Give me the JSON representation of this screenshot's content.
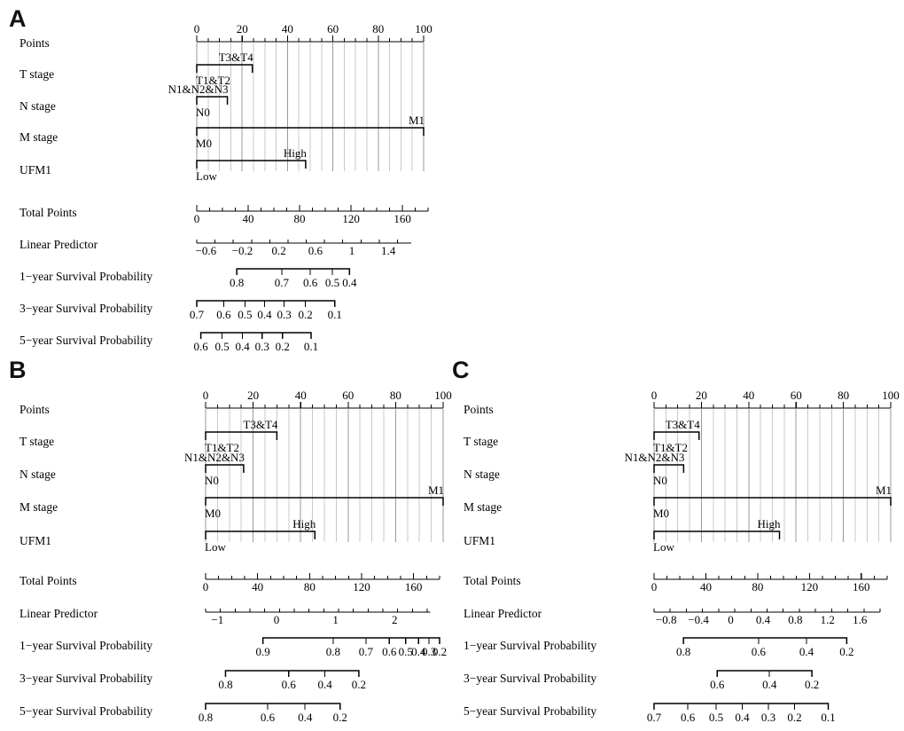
{
  "figure": {
    "type": "nomogram-figure",
    "panels": [
      "A",
      "B",
      "C"
    ]
  },
  "row_labels": {
    "points": "Points",
    "t_stage": "T stage",
    "n_stage": "N stage",
    "m_stage": "M stage",
    "ufm1": "UFM1",
    "total_points": "Total Points",
    "linear_predictor": "Linear Predictor",
    "surv1": "1−year Survival Probability",
    "surv3": "3−year Survival Probability",
    "surv5": "5−year Survival Probability"
  },
  "category_labels": {
    "t_low": "T1&T2",
    "t_high": "T3&T4",
    "n_low": "N0",
    "n_high": "N1&N2&N3",
    "m_low": "M0",
    "m_high": "M1",
    "ufm1_low": "Low",
    "ufm1_high": "High"
  },
  "chart_data": [
    {
      "id": "A",
      "type": "nomogram",
      "title": "A",
      "points_axis": {
        "label": "Points",
        "min": 0,
        "max": 100,
        "ticks": [
          0,
          20,
          40,
          60,
          80,
          100
        ],
        "tick_labels": [
          "0",
          "20",
          "40",
          "60",
          "80",
          "100"
        ],
        "minor_step": 5
      },
      "predictors": [
        {
          "name": "T stage",
          "levels": [
            {
              "label": "T1&T2",
              "points": 0,
              "side": "below"
            },
            {
              "label": "T3&T4",
              "points": 24.5,
              "side": "above"
            }
          ]
        },
        {
          "name": "N stage",
          "levels": [
            {
              "label": "N0",
              "points": 0,
              "side": "below"
            },
            {
              "label": "N1&N2&N3",
              "points": 13.5,
              "side": "above"
            }
          ]
        },
        {
          "name": "M stage",
          "levels": [
            {
              "label": "M0",
              "points": 0,
              "side": "below"
            },
            {
              "label": "M1",
              "points": 100,
              "side": "above"
            }
          ]
        },
        {
          "name": "UFM1",
          "levels": [
            {
              "label": "Low",
              "points": 0,
              "side": "below"
            },
            {
              "label": "High",
              "points": 48,
              "side": "above"
            }
          ]
        }
      ],
      "total_points": {
        "label": "Total Points",
        "min": 0,
        "max": 180,
        "ticks": [
          0,
          40,
          80,
          120,
          160
        ],
        "tick_labels": [
          "0",
          "40",
          "80",
          "120",
          "160"
        ],
        "minor_step": 10
      },
      "linear_predictor": {
        "label": "Linear Predictor",
        "min": -0.7,
        "max": 1.65,
        "ticks": [
          -0.6,
          -0.2,
          0.2,
          0.6,
          1,
          1.4
        ],
        "tick_labels": [
          "−0.6",
          "−0.2",
          "0.2",
          "0.6",
          "1",
          "1.4"
        ],
        "minor_step": 0.2
      },
      "survival": [
        {
          "label": "1−year Survival Probability",
          "ticks": [
            0.8,
            0.7,
            0.6,
            0.5,
            0.4
          ],
          "tick_labels": [
            "0.8",
            "0.7",
            "0.6",
            "0.5",
            "0.4"
          ],
          "positions": [
            0.245,
            0.52,
            0.695,
            0.83,
            0.935
          ]
        },
        {
          "label": "3−year Survival Probability",
          "ticks": [
            0.7,
            0.6,
            0.5,
            0.4,
            0.3,
            0.2,
            0.1
          ],
          "tick_labels": [
            "0.7",
            "0.6",
            "0.5",
            "0.4",
            "0.3",
            "0.2",
            "0.1"
          ],
          "positions": [
            0.0,
            0.165,
            0.295,
            0.415,
            0.535,
            0.665,
            0.845
          ]
        },
        {
          "label": "5−year Survival Probability",
          "ticks": [
            0.6,
            0.5,
            0.4,
            0.3,
            0.2,
            0.1
          ],
          "tick_labels": [
            "0.6",
            "0.5",
            "0.4",
            "0.3",
            "0.2",
            "0.1"
          ],
          "positions": [
            0.025,
            0.155,
            0.28,
            0.4,
            0.525,
            0.7
          ]
        }
      ]
    },
    {
      "id": "B",
      "type": "nomogram",
      "title": "B",
      "points_axis": {
        "label": "Points",
        "min": 0,
        "max": 100,
        "ticks": [
          0,
          20,
          40,
          60,
          80,
          100
        ],
        "tick_labels": [
          "0",
          "20",
          "40",
          "60",
          "80",
          "100"
        ],
        "minor_step": 5
      },
      "predictors": [
        {
          "name": "T stage",
          "levels": [
            {
              "label": "T1&T2",
              "points": 0,
              "side": "below"
            },
            {
              "label": "T3&T4",
              "points": 30,
              "side": "above"
            }
          ]
        },
        {
          "name": "N stage",
          "levels": [
            {
              "label": "N0",
              "points": 0,
              "side": "below"
            },
            {
              "label": "N1&N2&N3",
              "points": 16,
              "side": "above"
            }
          ]
        },
        {
          "name": "M stage",
          "levels": [
            {
              "label": "M0",
              "points": 0,
              "side": "below"
            },
            {
              "label": "M1",
              "points": 100,
              "side": "above"
            }
          ]
        },
        {
          "name": "UFM1",
          "levels": [
            {
              "label": "Low",
              "points": 0,
              "side": "below"
            },
            {
              "label": "High",
              "points": 46,
              "side": "above"
            }
          ]
        }
      ],
      "total_points": {
        "label": "Total Points",
        "min": 0,
        "max": 180,
        "ticks": [
          0,
          40,
          80,
          120,
          160
        ],
        "tick_labels": [
          "0",
          "40",
          "80",
          "120",
          "160"
        ],
        "minor_step": 10
      },
      "linear_predictor": {
        "label": "Linear Predictor",
        "min": -1.2,
        "max": 2.6,
        "ticks": [
          -1,
          0,
          1,
          2
        ],
        "tick_labels": [
          "−1",
          "0",
          "1",
          "2"
        ],
        "minor_step": 0.25
      },
      "survival": [
        {
          "label": "1−year Survival Probability",
          "ticks": [
            0.9,
            0.8,
            0.7,
            0.6,
            0.5,
            0.4,
            0.3,
            0.2
          ],
          "tick_labels": [
            "0.9",
            "0.8",
            "0.7",
            "0.6",
            "0.5",
            "0.4",
            "0.3",
            "0.2"
          ],
          "positions": [
            0.245,
            0.545,
            0.685,
            0.785,
            0.855,
            0.91,
            0.955,
            1.0
          ]
        },
        {
          "label": "3−year Survival Probability",
          "ticks": [
            0.8,
            0.6,
            0.4,
            0.2
          ],
          "tick_labels": [
            "0.8",
            "0.6",
            "0.4",
            "0.2"
          ],
          "positions": [
            0.085,
            0.355,
            0.51,
            0.655
          ]
        },
        {
          "label": "5−year Survival Probability",
          "ticks": [
            0.8,
            0.6,
            0.4,
            0.2
          ],
          "tick_labels": [
            "0.8",
            "0.6",
            "0.4",
            "0.2"
          ],
          "positions": [
            0.0,
            0.265,
            0.425,
            0.575
          ]
        }
      ]
    },
    {
      "id": "C",
      "type": "nomogram",
      "title": "C",
      "points_axis": {
        "label": "Points",
        "min": 0,
        "max": 100,
        "ticks": [
          0,
          20,
          40,
          60,
          80,
          100
        ],
        "tick_labels": [
          "0",
          "20",
          "40",
          "60",
          "80",
          "100"
        ],
        "minor_step": 5
      },
      "predictors": [
        {
          "name": "T stage",
          "levels": [
            {
              "label": "T1&T2",
              "points": 0,
              "side": "below"
            },
            {
              "label": "T3&T4",
              "points": 19,
              "side": "above"
            }
          ]
        },
        {
          "name": "N stage",
          "levels": [
            {
              "label": "N0",
              "points": 0,
              "side": "below"
            },
            {
              "label": "N1&N2&N3",
              "points": 12.5,
              "side": "above"
            }
          ]
        },
        {
          "name": "M stage",
          "levels": [
            {
              "label": "M0",
              "points": 0,
              "side": "below"
            },
            {
              "label": "M1",
              "points": 100,
              "side": "above"
            }
          ]
        },
        {
          "name": "UFM1",
          "levels": [
            {
              "label": "Low",
              "points": 0,
              "side": "below"
            },
            {
              "label": "High",
              "points": 53,
              "side": "above"
            }
          ]
        }
      ],
      "total_points": {
        "label": "Total Points",
        "min": 0,
        "max": 180,
        "ticks": [
          0,
          40,
          80,
          120,
          160
        ],
        "tick_labels": [
          "0",
          "40",
          "80",
          "120",
          "160"
        ],
        "minor_step": 10
      },
      "linear_predictor": {
        "label": "Linear Predictor",
        "min": -0.95,
        "max": 1.85,
        "ticks": [
          -0.8,
          -0.4,
          0,
          0.4,
          0.8,
          1.2,
          1.6
        ],
        "tick_labels": [
          "−0.8",
          "−0.4",
          "0",
          "0.4",
          "0.8",
          "1.2",
          "1.6"
        ],
        "minor_step": 0.2
      },
      "survival": [
        {
          "label": "1−year Survival Probability",
          "ticks": [
            0.8,
            0.6,
            0.4,
            0.2
          ],
          "tick_labels": [
            "0.8",
            "0.6",
            "0.4",
            "0.2"
          ],
          "positions": [
            0.135,
            0.48,
            0.7,
            0.885
          ]
        },
        {
          "label": "3−year Survival Probability",
          "ticks": [
            0.6,
            0.4,
            0.2
          ],
          "tick_labels": [
            "0.6",
            "0.4",
            "0.2"
          ],
          "positions": [
            0.29,
            0.53,
            0.725
          ]
        },
        {
          "label": "5−year Survival Probability",
          "ticks": [
            0.7,
            0.6,
            0.5,
            0.4,
            0.3,
            0.2,
            0.1
          ],
          "tick_labels": [
            "0.7",
            "0.6",
            "0.5",
            "0.4",
            "0.3",
            "0.2",
            "0.1"
          ],
          "positions": [
            0.0,
            0.155,
            0.285,
            0.405,
            0.525,
            0.645,
            0.8
          ]
        }
      ]
    }
  ]
}
